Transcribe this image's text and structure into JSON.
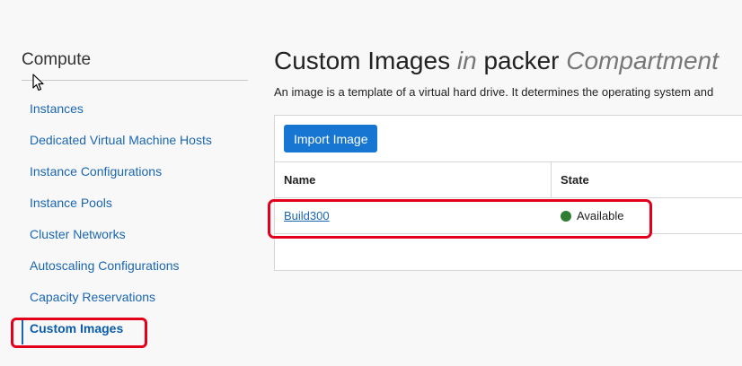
{
  "sidebar": {
    "title": "Compute",
    "items": [
      {
        "label": "Instances"
      },
      {
        "label": "Dedicated Virtual Machine Hosts"
      },
      {
        "label": "Instance Configurations"
      },
      {
        "label": "Instance Pools"
      },
      {
        "label": "Cluster Networks"
      },
      {
        "label": "Autoscaling Configurations"
      },
      {
        "label": "Capacity Reservations"
      },
      {
        "label": "Custom Images",
        "active": true
      }
    ]
  },
  "main": {
    "title_part1": "Custom Images",
    "title_part2": "in",
    "title_part3": "packer",
    "title_part4": "Compartment",
    "description": "An image is a template of a virtual hard drive. It determines the operating system and",
    "import_button": "Import Image",
    "table": {
      "headers": [
        "Name",
        "State"
      ],
      "rows": [
        {
          "name": "Build300",
          "state": "Available"
        }
      ]
    }
  },
  "colors": {
    "accent": "#1676d2",
    "link": "#1a66b0",
    "status_available": "#2e7d32",
    "highlight": "#e2001a"
  },
  "icons": {
    "cursor": "mouse-pointer-icon",
    "status": "status-dot-icon"
  }
}
